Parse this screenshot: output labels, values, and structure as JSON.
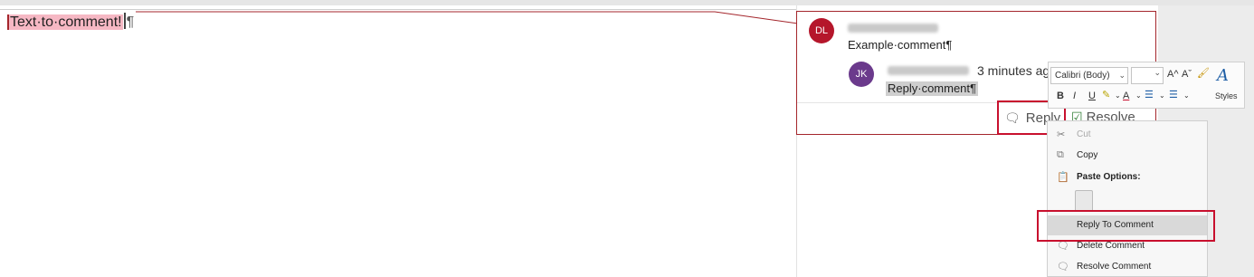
{
  "document": {
    "highlighted_text": "Text·to·comment!",
    "pilcrow": "¶"
  },
  "comment_thread": {
    "comment": {
      "avatar_initials": "DL",
      "text": "Example·comment¶"
    },
    "reply": {
      "avatar_initials": "JK",
      "time": "3 minutes ag",
      "text": "Reply·comment¶"
    },
    "actions": {
      "reply_label": "Reply",
      "resolve_label": "Resolve"
    }
  },
  "mini_toolbar": {
    "font": "Calibri (Body)",
    "size": "",
    "grow_font": "A^",
    "shrink_font": "Aˇ",
    "bold": "B",
    "italic": "I",
    "underline": "U",
    "font_color": "A",
    "styles_label": "Styles"
  },
  "context_menu": {
    "items": [
      {
        "label": "Cut",
        "icon": "scissors-icon",
        "enabled": false
      },
      {
        "label": "Copy",
        "icon": "copy-icon",
        "enabled": true
      },
      {
        "label": "Paste Options:",
        "icon": "paste-icon",
        "enabled": true
      },
      {
        "label": "Reply To Comment",
        "icon": "",
        "enabled": true
      },
      {
        "label": "Delete Comment",
        "icon": "delete-comment-icon",
        "enabled": true
      },
      {
        "label": "Resolve Comment",
        "icon": "resolve-comment-icon",
        "enabled": true
      }
    ]
  },
  "colors": {
    "accent_red": "#c8102e",
    "dl_avatar": "#b5162b",
    "jk_avatar": "#6b3a8c",
    "text_highlight": "#f6b8c4"
  }
}
